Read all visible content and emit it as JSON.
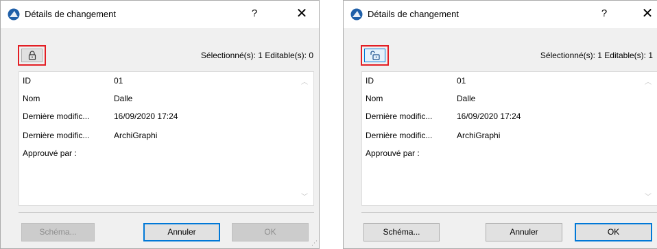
{
  "left_dialog": {
    "title": "Détails de changement",
    "help_label": "?",
    "close_label": "✕",
    "lock_state": "locked",
    "status": "Sélectionné(s): 1 Editable(s): 0",
    "properties": [
      {
        "label": "ID",
        "value": "01"
      },
      {
        "label": "Nom",
        "value": "Dalle"
      },
      {
        "label": "Dernière modific...",
        "value": "16/09/2020 17:24"
      },
      {
        "label": "Dernière modific...",
        "value": "ArchiGraphi"
      },
      {
        "label": "Approuvé par :",
        "value": ""
      }
    ],
    "buttons": {
      "schema": {
        "label": "Schéma...",
        "enabled": false
      },
      "cancel": {
        "label": "Annuler",
        "enabled": true
      },
      "ok": {
        "label": "OK",
        "enabled": false
      }
    }
  },
  "right_dialog": {
    "title": "Détails de changement",
    "help_label": "?",
    "close_label": "✕",
    "lock_state": "unlocked",
    "status": "Sélectionné(s): 1 Editable(s): 1",
    "properties": [
      {
        "label": "ID",
        "value": "01"
      },
      {
        "label": "Nom",
        "value": "Dalle"
      },
      {
        "label": "Dernière modific...",
        "value": "16/09/2020 17:24"
      },
      {
        "label": "Dernière modific...",
        "value": "ArchiGraphi"
      },
      {
        "label": "Approuvé par :",
        "value": ""
      }
    ],
    "buttons": {
      "schema": {
        "label": "Schéma...",
        "enabled": true
      },
      "cancel": {
        "label": "Annuler",
        "enabled": true
      },
      "ok": {
        "label": "OK",
        "enabled": true
      }
    }
  },
  "icons": {
    "app": "archicad-app-icon",
    "lock_closed": "padlock-closed-icon",
    "lock_open": "padlock-open-icon",
    "scroll_up": "chevron-up-icon",
    "scroll_down": "chevron-down-icon",
    "resize": "resize-grip-icon"
  },
  "colors": {
    "highlight_box": "#e31e24",
    "default_button_border": "#0078d7",
    "dialog_bg": "#f0f0f0",
    "app_icon_blue": "#1f5fa8"
  }
}
